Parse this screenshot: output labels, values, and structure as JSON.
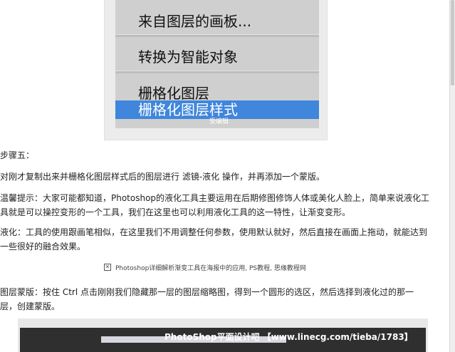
{
  "menu": {
    "items": [
      {
        "label": "来自图层的画板..."
      },
      {
        "label": "转换为智能对象"
      },
      {
        "label": "栅格化图层"
      },
      {
        "label": "栅格化图层样式",
        "highlighted": true
      }
    ],
    "highlight_color": "#3f86dc",
    "small_watermark": "受编辑"
  },
  "article": {
    "step_heading": "步骤五：",
    "p1": "对刚才复制出来并栅格化图层样式后的图层进行 滤镜-液化 操作，并再添加一个蒙版。",
    "p2": "温馨提示：大家可能都知道，Photoshop的液化工具主要运用在后期修图修饰人体或美化人脸上，简单来说液化工具就是可以操控变形的一个工具，我们在这里也可以利用液化工具的这一特性，让渐变变形。",
    "p3": "液化：工具的使用跟画笔相似，在这里我们不用调整任何参数，使用默认就好，然后直接在画面上拖动，就能达到一些很好的融合效果。",
    "image_caption": "Photoshop详细解析渐变工具在海报中的应用, PS教程, 思缘教程网",
    "p4": "图层蒙版：按住 Ctrl 点击刚刚我们隐藏那一层的图层缩略图，得到一个圆形的选区，然后选择到液化过的那一层，创建蒙版。"
  },
  "bottom_image": {
    "watermark": "PhotoShop平面设计吧 【www.linecg.com/tieba/1783】"
  }
}
